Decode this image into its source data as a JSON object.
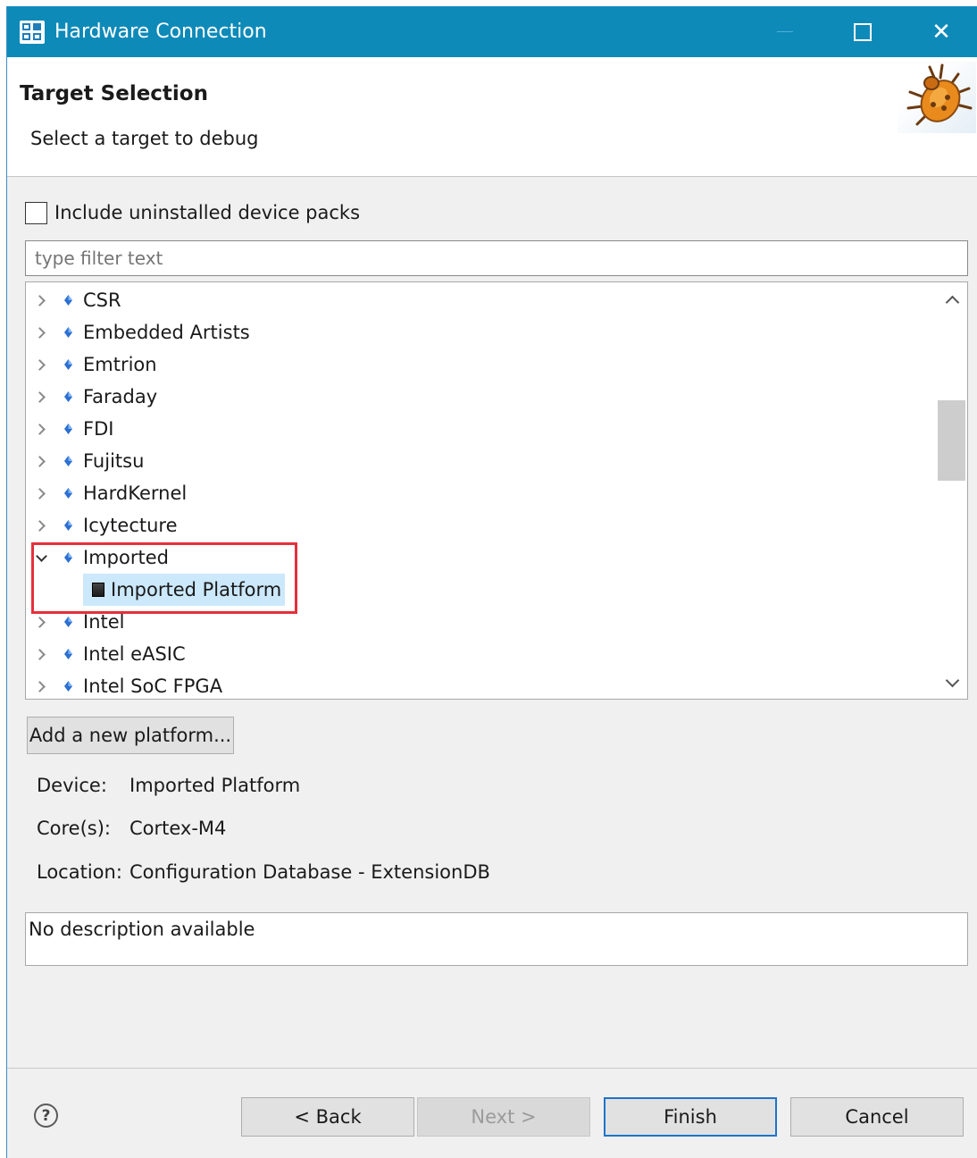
{
  "window": {
    "title": "Hardware Connection",
    "controls": {
      "minimize": "minimize",
      "maximize": "maximize",
      "close": "✕"
    }
  },
  "header": {
    "title": "Target Selection",
    "subtitle": "Select a target to debug",
    "image_icon": "bug-icon"
  },
  "options": {
    "include_uninstalled_label": "Include uninstalled device packs",
    "include_uninstalled_checked": false
  },
  "filter": {
    "placeholder": "type filter text",
    "value": ""
  },
  "tree": {
    "items": [
      {
        "label": "CSR",
        "expanded": false
      },
      {
        "label": "Embedded Artists",
        "expanded": false
      },
      {
        "label": "Emtrion",
        "expanded": false
      },
      {
        "label": "Faraday",
        "expanded": false
      },
      {
        "label": "FDI",
        "expanded": false
      },
      {
        "label": "Fujitsu",
        "expanded": false
      },
      {
        "label": "HardKernel",
        "expanded": false
      },
      {
        "label": "Icytecture",
        "expanded": false
      },
      {
        "label": "Imported",
        "expanded": true
      },
      {
        "label": "Imported Platform",
        "child": true,
        "selected": true
      },
      {
        "label": "Intel",
        "expanded": false
      },
      {
        "label": "Intel eASIC",
        "expanded": false
      },
      {
        "label": "Intel SoC FPGA",
        "expanded": false
      }
    ]
  },
  "buttons": {
    "add_platform": "Add a new platform...",
    "back": "< Back",
    "next": "Next >",
    "finish": "Finish",
    "cancel": "Cancel",
    "help": "?"
  },
  "info": {
    "device_label": "Device:",
    "device_value": "Imported Platform",
    "cores_label": "Core(s):",
    "cores_value": "Cortex-M4",
    "location_label": "Location:",
    "location_value": "Configuration Database - ExtensionDB"
  },
  "description": "No description available",
  "colors": {
    "titlebar": "#0e8ab9",
    "selection": "#cce8fb",
    "highlight_border": "#e5303b",
    "default_button_border": "#1d74c9"
  }
}
